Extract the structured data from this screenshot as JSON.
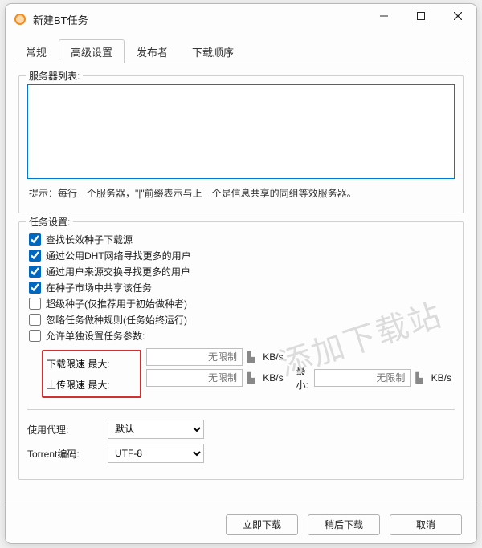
{
  "window": {
    "title": "新建BT任务"
  },
  "tabs": [
    "常规",
    "高级设置",
    "发布者",
    "下载顺序"
  ],
  "active_tab": 1,
  "server_group": {
    "legend": "服务器列表:",
    "value": "",
    "hint": "提示：每行一个服务器，\"|\"前缀表示与上一个是信息共享的同组等效服务器。"
  },
  "task_group": {
    "legend": "任务设置:",
    "checks": [
      {
        "label": "查找长效种子下载源",
        "checked": true
      },
      {
        "label": "通过公用DHT网络寻找更多的用户",
        "checked": true
      },
      {
        "label": "通过用户来源交换寻找更多的用户",
        "checked": true
      },
      {
        "label": "在种子市场中共享该任务",
        "checked": true
      },
      {
        "label": "超级种子(仅推荐用于初始做种者)",
        "checked": false
      },
      {
        "label": "忽略任务做种规则(任务始终运行)",
        "checked": false
      },
      {
        "label": "允许单独设置任务参数:",
        "checked": false
      }
    ],
    "dl_label": "下载限速  最大:",
    "ul_label": "上传限速  最大:",
    "nolimit": "无限制",
    "kbs": "KB/s",
    "min_label": "最小:"
  },
  "proxy": {
    "label": "使用代理:",
    "value": "默认"
  },
  "encoding": {
    "label": "Torrent编码:",
    "value": "UTF-8"
  },
  "buttons": {
    "now": "立即下载",
    "later": "稍后下载",
    "cancel": "取消"
  },
  "watermark": "添加下载站"
}
